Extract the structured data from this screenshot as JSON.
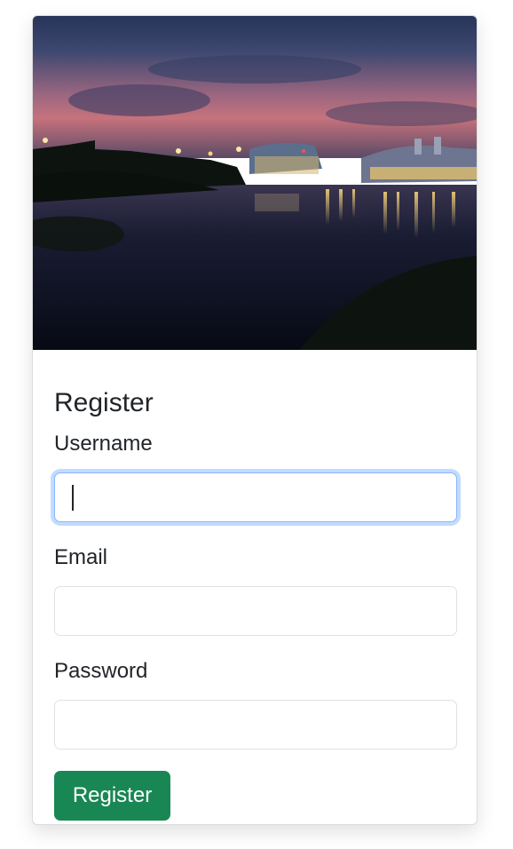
{
  "card": {
    "image": {
      "description_colors": {
        "sky_top": "#2d3a5c",
        "sky_horizon": "#c06a7a",
        "water": "#0b1020"
      }
    },
    "title": "Register",
    "fields": [
      {
        "label": "Username",
        "value": "",
        "placeholder": ""
      },
      {
        "label": "Email",
        "value": "",
        "placeholder": ""
      },
      {
        "label": "Password",
        "value": "",
        "placeholder": ""
      }
    ],
    "submit_label": "Register",
    "colors": {
      "button": "#198754",
      "focus_ring": "#86b7fe"
    }
  }
}
